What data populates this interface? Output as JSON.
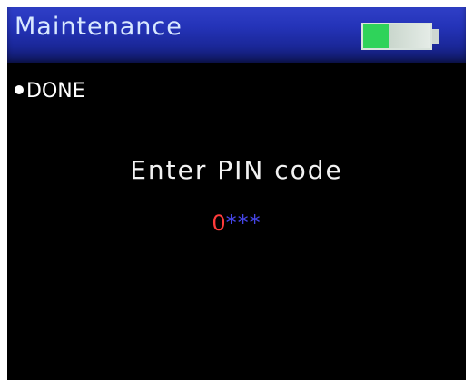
{
  "header": {
    "title": "Maintenance",
    "battery_icon": "battery-icon",
    "battery_level": 0.38
  },
  "status": {
    "label": "DONE",
    "bullet_icon": "bullet-dot-icon"
  },
  "pin_entry": {
    "prompt": "Enter PIN code",
    "current_digit": "0",
    "masked_digits": "***"
  },
  "colors": {
    "header_bar": "#2433b8",
    "current_digit": "#ff3b3b",
    "masked_digits": "#4545e8",
    "battery_fill": "#2fd35a"
  }
}
